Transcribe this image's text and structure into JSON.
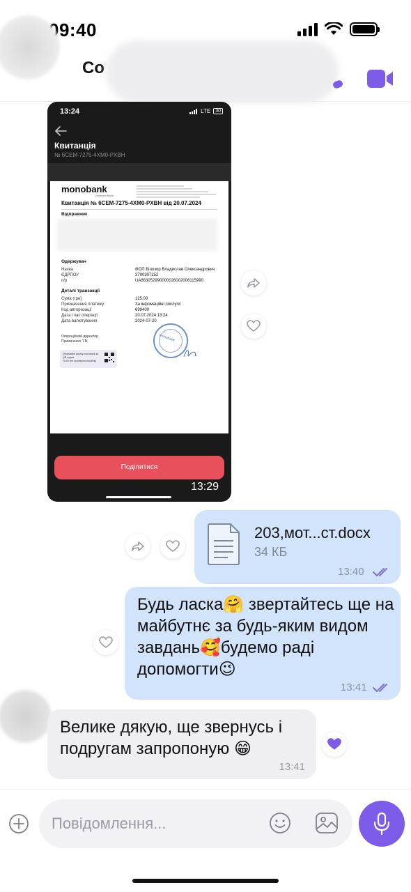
{
  "status_bar": {
    "time": "09:40"
  },
  "header": {
    "name_visible": "Co"
  },
  "image_message": {
    "status_time": "13:24",
    "status_network": "LTE",
    "status_battery": "30",
    "title": "Квитанція",
    "subtitle": "№ 6CEM-7275-4XM0-PXBH",
    "receipt": {
      "logo": "monobank",
      "logo_sub": "Universal Bank",
      "heading": "Квитанція № 6CEM-7275-4XM0-PXBH від 20.07.2024",
      "sender_label": "Відправник",
      "recipient_header": "Одержувач",
      "recipient_rows": [
        {
          "label": "Назва",
          "value": "ФОП Білозор Владислав Олександрович"
        },
        {
          "label": "ЄДРПОУ",
          "value": "3790307252"
        },
        {
          "label": "п/р",
          "value": "UA863052990000026002006115990"
        }
      ],
      "details_header": "Деталі транзакції",
      "detail_rows": [
        {
          "label": "Сума (грн)",
          "value": "125.00"
        },
        {
          "label": "Призначення платежу",
          "value": "За інфомаційні послуги"
        },
        {
          "label": "Код авторизації",
          "value": "699409"
        },
        {
          "label": "Дата і час операції",
          "value": "20.07.2024 13:24"
        },
        {
          "label": "Дата валютування",
          "value": "2024-07-20"
        }
      ],
      "director_label": "Операційний директор",
      "director_name": "Примаченко Т.В.",
      "promo_text": "Отримайте картку monobank за QR-кодом",
      "promo_sub": "Та 50 грн на рахунок кешбеку",
      "stamp_text": "monobank"
    },
    "share_button": "Поділитися",
    "time": "13:29"
  },
  "file_message": {
    "name": "203,мот...ст.docx",
    "size": "34 КБ",
    "time": "13:40"
  },
  "outgoing_text": {
    "text": "Будь ласка🤗 звертайтесь ще на майбутнє за будь-яким видом завдань🥰будемо раді допомогти😉",
    "time": "13:41"
  },
  "incoming_text": {
    "text": "Велике дякую, ще звернусь і подругам запропоную 😁",
    "time": "13:41"
  },
  "composer": {
    "placeholder": "Повідомлення..."
  },
  "colors": {
    "accent": "#7c5ce8",
    "outgoing_bubble": "#d2e4fb",
    "incoming_bubble": "#efeff1",
    "share_button": "#e8505b"
  }
}
